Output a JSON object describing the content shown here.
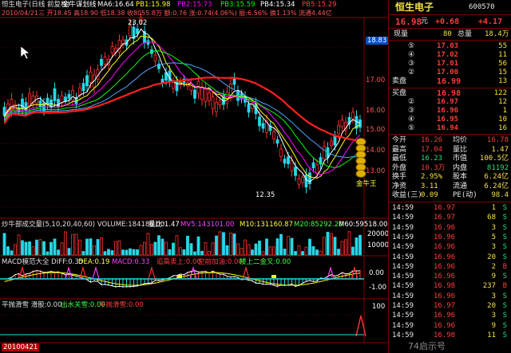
{
  "header": {
    "title": "恒生电子(日线 前复权)",
    "indicator": "金牛谋划线",
    "ma_items": [
      {
        "label": "MA6:16.64",
        "color": "#ffffff"
      },
      {
        "label": "PB1:15.98",
        "color": "#ffff00"
      },
      {
        "label": "PB2:15.73",
        "color": "#ff00ff"
      },
      {
        "label": "PB3:15.59",
        "color": "#00ff00"
      },
      {
        "label": "PB4:15.34",
        "color": "#ffffff"
      },
      {
        "label": "PB5:15.29",
        "color": "#ff4040"
      }
    ],
    "info_line": "2010/04/21三 开18.45 高18.90 低18.38 收8055.8万 额:0.76 涨:0.74(4.06%) 振:6.56% 换1.13% 流通4.44亿"
  },
  "main_chart": {
    "price_high_label": "23.02",
    "price_low_label": "12.35",
    "price_axis": [
      "17.00",
      "16.00",
      "15.00",
      "14.00",
      "13.00",
      "18.83"
    ],
    "gold_label": "金牛王"
  },
  "volume": {
    "header": [
      {
        "text": "炒牛部成交量(5,10,20,40,60) VOLUME:184186.00",
        "color": "#e0e0e0"
      },
      {
        "text": "量比:1.47",
        "color": "#ffffff"
      },
      {
        "text": "MV5:143101.00",
        "color": "#ff40ff"
      },
      {
        "text": "M10:131160.87",
        "color": "#ffff40"
      },
      {
        "text": "M20:85292.20",
        "color": "#40ff40"
      },
      {
        "text": "M60:59518.00",
        "color": "#ffffff"
      }
    ],
    "axis": [
      "20000",
      "10000"
    ]
  },
  "macd": {
    "header": [
      {
        "text": "MACD模范大全 DIFF:0.35",
        "color": "#e0e0e0"
      },
      {
        "text": "DEA:0.19",
        "color": "#ffff40"
      },
      {
        "text": "MACD:0.33",
        "color": "#ff40ff"
      },
      {
        "text": "追高卖上:0.00",
        "color": "#ff4040"
      },
      {
        "text": "空前加油:0.00",
        "color": "#ff4040"
      },
      {
        "text": "楼上二金叉:0.00",
        "color": "#40ff40"
      }
    ],
    "axis": [
      "0.00",
      "-1.00"
    ]
  },
  "bottom": {
    "header": [
      {
        "text": "平抛滑雪 滑股:0.00",
        "color": "#e0e0e0"
      },
      {
        "text": "出水关雪:0.00",
        "color": "#40ff40"
      },
      {
        "text": "平抛滑雪:0.00",
        "color": "#ff4040"
      }
    ],
    "axis": [
      "100"
    ],
    "date_tab": "20100421"
  },
  "quote": {
    "stock_name": "恒生电子",
    "stock_code": "600570",
    "price": "16.98",
    "price_unit": "元",
    "change": "+0.68",
    "change_pct": "+4.17",
    "hands_label": "现量",
    "hands_value": "80",
    "total_label": "总量",
    "total_value": "18.4万",
    "sells": [
      {
        "level": "⑤",
        "price": "17.03",
        "vol": "55"
      },
      {
        "level": "④",
        "price": "17.02",
        "vol": "11"
      },
      {
        "level": "③",
        "price": "17.01",
        "vol": "56"
      },
      {
        "level": "②",
        "price": "17.00",
        "vol": "15"
      },
      {
        "level": "①",
        "price": "16.99",
        "vol": "13"
      }
    ],
    "sell1_label": "卖盘",
    "buy1_label": "买盘",
    "buys": [
      {
        "level": "①",
        "price": "16.98",
        "vol": "122"
      },
      {
        "level": "②",
        "price": "16.97",
        "vol": "12"
      },
      {
        "level": "③",
        "price": "16.96",
        "vol": "1"
      },
      {
        "level": "④",
        "price": "16.95",
        "vol": "10"
      },
      {
        "level": "⑤",
        "price": "16.94",
        "vol": "16"
      }
    ],
    "stats": [
      [
        "今开",
        "16.26",
        "均价",
        "16.78"
      ],
      [
        "最高",
        "17.04",
        "量比",
        "1.47"
      ],
      [
        "最低",
        "16.23",
        "市值",
        "100.5亿"
      ],
      [
        "外盘",
        "10.3万",
        "内盘",
        "81192"
      ],
      [
        "换手",
        "2.95%",
        "股本",
        "6.24亿"
      ],
      [
        "净资",
        "3.11",
        "流通",
        "6.24亿"
      ],
      [
        "收益(三)",
        "0.09",
        "PE(动)",
        "98.4"
      ]
    ],
    "ticks": [
      {
        "time": "14:59",
        "price": "16.97",
        "vol": "1",
        "side": "S"
      },
      {
        "time": "14:59",
        "price": "16.97",
        "vol": "68",
        "side": "S"
      },
      {
        "time": "14:59",
        "price": "16.96",
        "vol": "3",
        "side": "S"
      },
      {
        "time": "14:59",
        "price": "16.96",
        "vol": "5",
        "side": "S"
      },
      {
        "time": "14:59",
        "price": "16.96",
        "vol": "3",
        "side": "S"
      },
      {
        "time": "14:59",
        "price": "16.96",
        "vol": "20",
        "side": "S"
      },
      {
        "time": "14:59",
        "price": "16.96",
        "vol": "2",
        "side": "B"
      },
      {
        "time": "14:59",
        "price": "16.96",
        "vol": "9",
        "side": "S"
      },
      {
        "time": "14:59",
        "price": "16.98",
        "vol": "237",
        "side": "B"
      },
      {
        "time": "14:59",
        "price": "16.96",
        "vol": "3",
        "side": "S"
      },
      {
        "time": "14:59",
        "price": "16.97",
        "vol": "20",
        "side": "S"
      },
      {
        "time": "14:59",
        "price": "16.96",
        "vol": "3",
        "side": "S"
      },
      {
        "time": "14:59",
        "price": "16.96",
        "vol": "9",
        "side": "S"
      },
      {
        "time": "14:59",
        "price": "16.98",
        "vol": "11",
        "side": "S"
      }
    ],
    "watermark": "74启示号"
  }
}
